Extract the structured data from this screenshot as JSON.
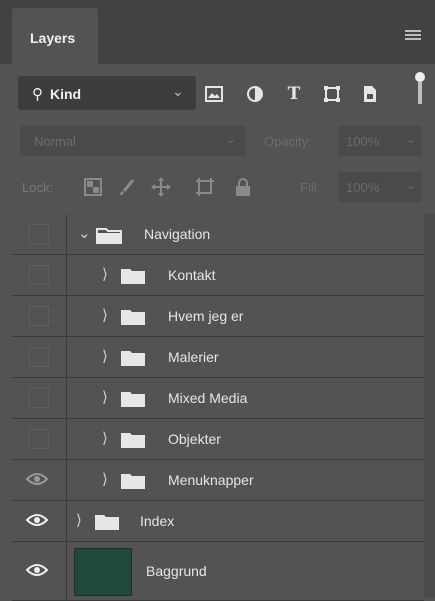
{
  "panel": {
    "tab_label": "Layers",
    "colors": {
      "background": "#535353",
      "tabbar": "#424242",
      "thumbnail": "#1f4a3d"
    }
  },
  "filter": {
    "search_icon": "search-icon",
    "kind_label": "Kind",
    "icons": [
      "image-filter-icon",
      "adjustment-filter-icon",
      "type-filter-icon",
      "shape-filter-icon",
      "smart-object-filter-icon",
      "filter-toggle-icon"
    ],
    "type_glyph": "T"
  },
  "blend": {
    "mode": "Normal",
    "opacity_label": "Opacity:",
    "opacity_value": "100%"
  },
  "lock": {
    "label": "Lock:",
    "fill_label": "Fill:",
    "fill_value": "100%"
  },
  "layers": [
    {
      "name": "Navigation",
      "visible": false,
      "type": "group",
      "expanded": true,
      "depth": 0
    },
    {
      "name": "Kontakt",
      "visible": false,
      "type": "group",
      "expanded": false,
      "depth": 1
    },
    {
      "name": "Hvem jeg er",
      "visible": false,
      "type": "group",
      "expanded": false,
      "depth": 1
    },
    {
      "name": "Malerier",
      "visible": false,
      "type": "group",
      "expanded": false,
      "depth": 1
    },
    {
      "name": "Mixed Media",
      "visible": false,
      "type": "group",
      "expanded": false,
      "depth": 1
    },
    {
      "name": "Objekter",
      "visible": false,
      "type": "group",
      "expanded": false,
      "depth": 1
    },
    {
      "name": "Menuknapper",
      "visible": true,
      "type": "group",
      "expanded": false,
      "depth": 1
    },
    {
      "name": "Index",
      "visible": true,
      "type": "group",
      "expanded": false,
      "depth": 0
    },
    {
      "name": "Baggrund",
      "visible": true,
      "type": "image",
      "depth": 0
    }
  ]
}
